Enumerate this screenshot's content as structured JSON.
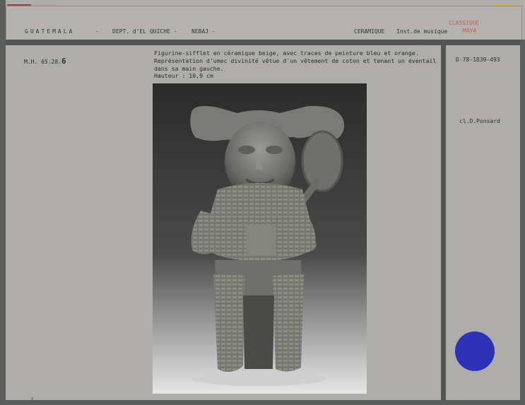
{
  "header": {
    "country": "GUATEMALA",
    "sep1": "-",
    "dept": "DEPT. d'EL QUICHE -",
    "place": "NEBAJ -",
    "type": "CERAMIQUE",
    "instrument": "Inst.de musique",
    "stamp_line1": "CLASSIQUE",
    "stamp_line2": "MAYA"
  },
  "inventory": {
    "prefix": "M.H. 65.28.",
    "suffix": "6"
  },
  "description": {
    "line1": "Figurine-sifflet en céramique beige, avec traces de peinture bleu et orange.",
    "line2": "Représentation d'umec divinité vêtue d'un vêtement de coton et tenant un éventail",
    "line3": "dans sa main gauche.",
    "line4": "Hauteur : 10,9 cm"
  },
  "reference": "D-78-1839-493",
  "credit": "cl.D.Ponsard",
  "corner_mark": "F",
  "colors": {
    "card": "#aeadaa",
    "rule": "#525554",
    "stamp": "#d45a55",
    "blue_dot": "#2d33b7",
    "tape_red": "#b2343a",
    "tape_yellow": "#d8b13a"
  }
}
